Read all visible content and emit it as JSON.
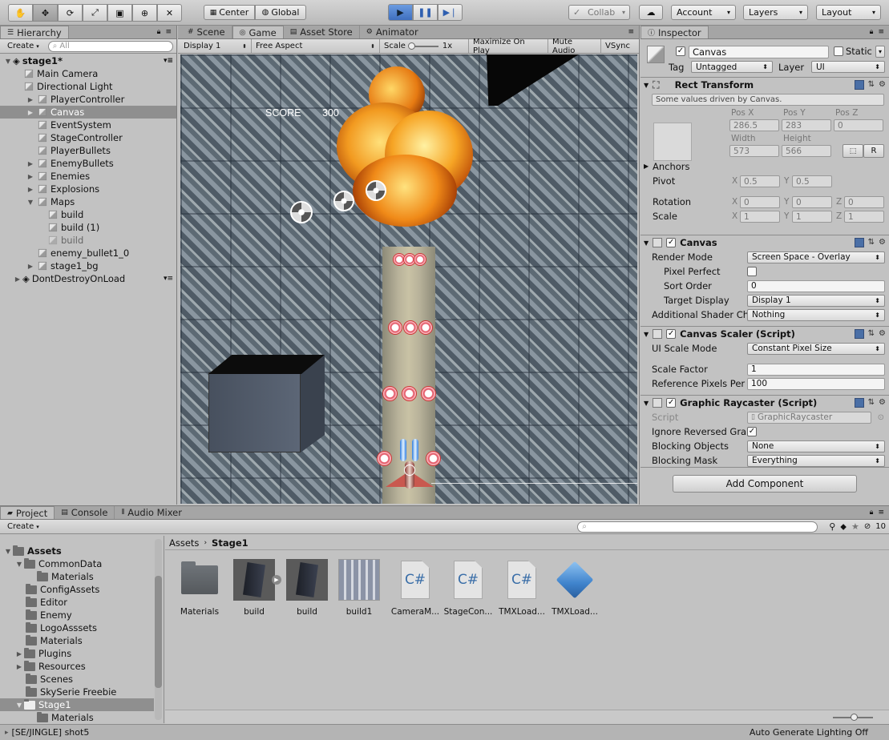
{
  "toolbar": {
    "pivot_label": "Center",
    "space_label": "Global",
    "collab_label": "Collab",
    "account_label": "Account",
    "layers_label": "Layers",
    "layout_label": "Layout"
  },
  "hierarchy": {
    "tab": "Hierarchy",
    "create": "Create",
    "search_placeholder": "All",
    "items": [
      {
        "label": "stage1*"
      },
      {
        "label": "Main Camera"
      },
      {
        "label": "Directional Light"
      },
      {
        "label": "PlayerController"
      },
      {
        "label": "Canvas"
      },
      {
        "label": "EventSystem"
      },
      {
        "label": "StageController"
      },
      {
        "label": "PlayerBullets"
      },
      {
        "label": "EnemyBullets"
      },
      {
        "label": "Enemies"
      },
      {
        "label": "Explosions"
      },
      {
        "label": "Maps"
      },
      {
        "label": "build"
      },
      {
        "label": "build (1)"
      },
      {
        "label": "build"
      },
      {
        "label": "enemy_bullet1_0"
      },
      {
        "label": "stage1_bg"
      },
      {
        "label": "DontDestroyOnLoad"
      }
    ]
  },
  "game_view": {
    "tabs": [
      {
        "label": "Scene"
      },
      {
        "label": "Game"
      },
      {
        "label": "Asset Store"
      },
      {
        "label": "Animator"
      }
    ],
    "display": "Display 1",
    "aspect": "Free Aspect",
    "scale_label": "Scale",
    "scale_value": "1x",
    "maximize": "Maximize On Play",
    "mute": "Mute Audio",
    "vsync": "VSync",
    "score_label": "SCORE",
    "score_value": "300"
  },
  "inspector": {
    "tab": "Inspector",
    "object_name": "Canvas",
    "static_label": "Static",
    "tag_label": "Tag",
    "tag_value": "Untagged",
    "layer_label": "Layer",
    "layer_value": "UI",
    "rect_transform": {
      "title": "Rect Transform",
      "note": "Some values driven by Canvas.",
      "posx_label": "Pos X",
      "posx": "286.5",
      "posy_label": "Pos Y",
      "posy": "283",
      "posz_label": "Pos Z",
      "posz": "0",
      "width_label": "Width",
      "width": "573",
      "height_label": "Height",
      "height": "566",
      "r_button": "R",
      "anchors": "Anchors",
      "pivot": "Pivot",
      "pivot_x": "0.5",
      "pivot_y": "0.5",
      "rotation": "Rotation",
      "rot_x": "0",
      "rot_y": "0",
      "rot_z": "0",
      "scale": "Scale",
      "scale_x": "1",
      "scale_y": "1",
      "scale_z": "1",
      "x": "X",
      "y": "Y",
      "z": "Z"
    },
    "canvas": {
      "title": "Canvas",
      "render_mode_label": "Render Mode",
      "render_mode": "Screen Space - Overlay",
      "pixel_perfect_label": "Pixel Perfect",
      "sort_order_label": "Sort Order",
      "sort_order": "0",
      "target_display_label": "Target Display",
      "target_display": "Display 1",
      "shader_label": "Additional Shader Ch",
      "shader": "Nothing"
    },
    "scaler": {
      "title": "Canvas Scaler (Script)",
      "mode_label": "UI Scale Mode",
      "mode": "Constant Pixel Size",
      "factor_label": "Scale Factor",
      "factor": "1",
      "ref_label": "Reference Pixels Per",
      "ref": "100"
    },
    "raycaster": {
      "title": "Graphic Raycaster (Script)",
      "script_label": "Script",
      "script": "GraphicRaycaster",
      "ignore_label": "Ignore Reversed Gra",
      "blocking_label": "Blocking Objects",
      "blocking": "None",
      "mask_label": "Blocking Mask",
      "mask": "Everything"
    },
    "add_component": "Add Component"
  },
  "project": {
    "tabs": [
      {
        "label": "Project"
      },
      {
        "label": "Console"
      },
      {
        "label": "Audio Mixer"
      }
    ],
    "create": "Create",
    "filter_count": "10",
    "tree": [
      {
        "label": "Assets"
      },
      {
        "label": "CommonData"
      },
      {
        "label": "Materials"
      },
      {
        "label": "ConfigAssets"
      },
      {
        "label": "Editor"
      },
      {
        "label": "Enemy"
      },
      {
        "label": "LogoAsssets"
      },
      {
        "label": "Materials"
      },
      {
        "label": "Plugins"
      },
      {
        "label": "Resources"
      },
      {
        "label": "Scenes"
      },
      {
        "label": "SkySerie Freebie"
      },
      {
        "label": "Stage1"
      },
      {
        "label": "Materials"
      }
    ],
    "breadcrumb_root": "Assets",
    "breadcrumb_current": "Stage1",
    "assets": [
      {
        "label": "Materials"
      },
      {
        "label": "build"
      },
      {
        "label": "build"
      },
      {
        "label": "build1"
      },
      {
        "label": "CameraM..."
      },
      {
        "label": "StageCon..."
      },
      {
        "label": "TMXLoad..."
      },
      {
        "label": "TMXLoad..."
      }
    ],
    "cs_glyph": "C#"
  },
  "status": {
    "left": "[SE/JINGLE] shot5",
    "right": "Auto Generate Lighting Off"
  }
}
